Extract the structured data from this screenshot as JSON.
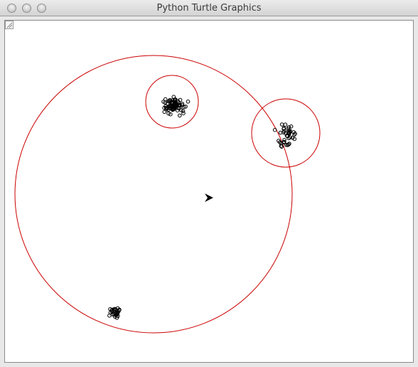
{
  "window": {
    "title": "Python Turtle Graphics"
  },
  "icons": {
    "close": "close-button",
    "minimize": "minimize-button",
    "zoom": "zoom-button",
    "turtle": "turtle-arrow-icon",
    "resize": "resize-grip-icon"
  },
  "colors": {
    "circle_stroke": "#cc0000",
    "dot_stroke": "#000000",
    "turtle_fill": "#000000",
    "canvas_bg": "#ffffff"
  }
}
